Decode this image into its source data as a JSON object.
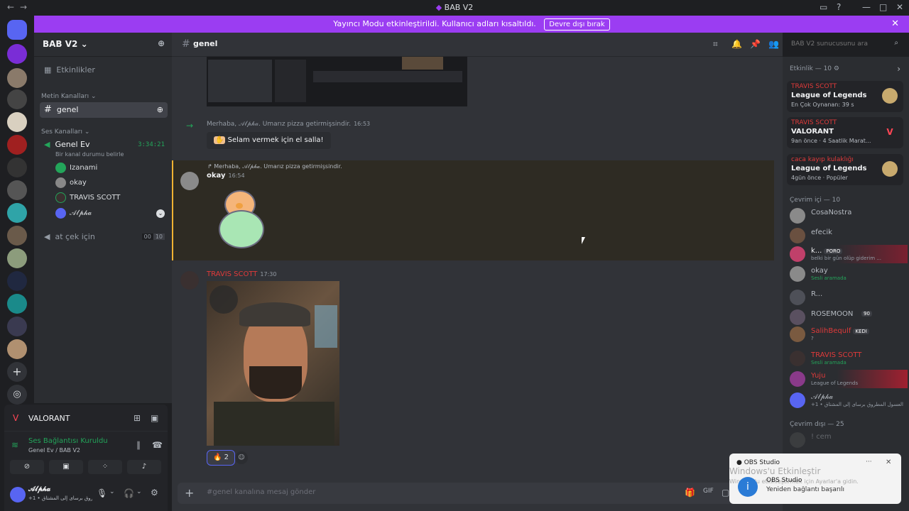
{
  "window": {
    "title": "BAB V2"
  },
  "banner": {
    "text": "Yayıncı Modu etkinleştirildi. Kullanıcı adları kısaltıldı.",
    "button": "Devre dışı bırak"
  },
  "server": {
    "name": "BAB V2"
  },
  "sidebar": {
    "events": "Etkinlikler",
    "text_category": "Metin Kanalları",
    "text_channel": "genel",
    "voice_category": "Ses Kanalları",
    "voice_channel": "Genel Ev",
    "voice_timer": "3:34:21",
    "voice_status": "Bir kanal durumu belirle",
    "voice_users": [
      "Izanami",
      "okay",
      "TRAVIS SCOTT",
      "𝒜𝓁𝓅𝒽𝒶"
    ],
    "voice_channel2": "at çek için",
    "voice2_count": "00",
    "voice2_limit": "10"
  },
  "panel": {
    "activity": "VALORANT",
    "connection": "Ses Bağlantısı Kuruldu",
    "connection_sub": "Genel Ev / BAB V2",
    "user": "𝒜𝓁𝓅𝒽𝒶",
    "user_status": "+1 • العسول المطروق برسای إلى المشتاق"
  },
  "chat": {
    "channel": "genel",
    "search_placeholder": "BAB V2 sunucusunu ara",
    "welcome_text": "Merhaba, 𝒜𝓁𝓅𝒽𝒶. Umarız pizza getirmişsindir.",
    "welcome_time": "16:53",
    "wave_button": "Selam vermek için el salla!",
    "reply_text": "Merhaba, 𝒜𝓁𝓅𝒽𝒶. Umarız pizza getirmişsindir.",
    "msg1_author": "okay",
    "msg1_time": "16:54",
    "msg2_author": "TRAVIS SCOTT",
    "msg2_time": "17:30",
    "reaction_count": "2",
    "composer_placeholder": "#genel kanalına mesaj gönder"
  },
  "members": {
    "activity_header": "Etkinlik — 10",
    "activities": [
      {
        "user": "TRAVIS SCOTT",
        "game": "League of Legends",
        "detail": "En Çok Oynanan: 39 s"
      },
      {
        "user": "TRAVIS SCOTT",
        "game": "VALORANT",
        "detail": "9an önce · 4 Saatlik Marat..."
      },
      {
        "user": "caca kayıp kulaklığı",
        "game": "League of Legends",
        "detail": "4gün önce · Popüler"
      }
    ],
    "online_header": "Çevrim içi — 10",
    "online": [
      {
        "name": "CosaNostra",
        "sub": ""
      },
      {
        "name": "efecik",
        "sub": ""
      },
      {
        "name": "k...",
        "tag": "PORO",
        "sub": "belki bir gün olüp giderim ..."
      },
      {
        "name": "okay",
        "sub": "Sesli aramada"
      },
      {
        "name": "R...",
        "sub": ""
      },
      {
        "name": "ROSEMOON",
        "tag": "90",
        "sub": ""
      },
      {
        "name": "SalihBequlf",
        "tag": "KEDI",
        "sub": "?"
      },
      {
        "name": "TRAVIS SCOTT",
        "sub": "Sesli aramada"
      },
      {
        "name": "Yuju",
        "sub": "League of Legends"
      },
      {
        "name": "𝒜𝓁𝓅𝒽𝒶",
        "sub": "+1 • العسول المطروق برسای إلى المشتاق"
      }
    ],
    "offline_header": "Çevrim dışı — 25",
    "offline": [
      {
        "name": "! cem"
      }
    ]
  },
  "toast": {
    "app": "OBS Studio",
    "watermark1": "Windows'u Etkinleştir",
    "watermark2": "Windows'u etkinleştirmek için Ayarlar'a gidin.",
    "title": "OBS Studio",
    "body": "Yeniden bağlantı başarılı"
  },
  "colors": {
    "accent": "#9b3df2",
    "brand": "#5865f2",
    "green": "#23a55a",
    "red": "#e03a3a"
  }
}
